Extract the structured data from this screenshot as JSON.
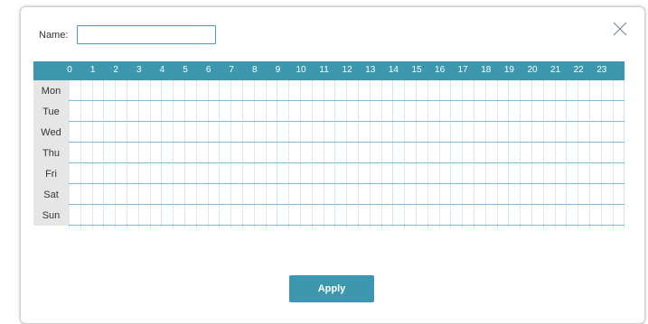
{
  "dialog": {
    "name_label": "Name:",
    "name_value": "",
    "name_placeholder": "",
    "apply_label": "Apply",
    "close_icon": "close-x-icon"
  },
  "schedule": {
    "hours": [
      "0",
      "1",
      "2",
      "3",
      "4",
      "5",
      "6",
      "7",
      "8",
      "9",
      "10",
      "11",
      "12",
      "13",
      "14",
      "15",
      "16",
      "17",
      "18",
      "19",
      "20",
      "21",
      "22",
      "23"
    ],
    "days": [
      "Mon",
      "Tue",
      "Wed",
      "Thu",
      "Fri",
      "Sat",
      "Sun"
    ]
  },
  "colors": {
    "accent": "#3d97ae",
    "day_label_bg": "#e6e6e6",
    "grid_line": "#7fbcd0"
  }
}
